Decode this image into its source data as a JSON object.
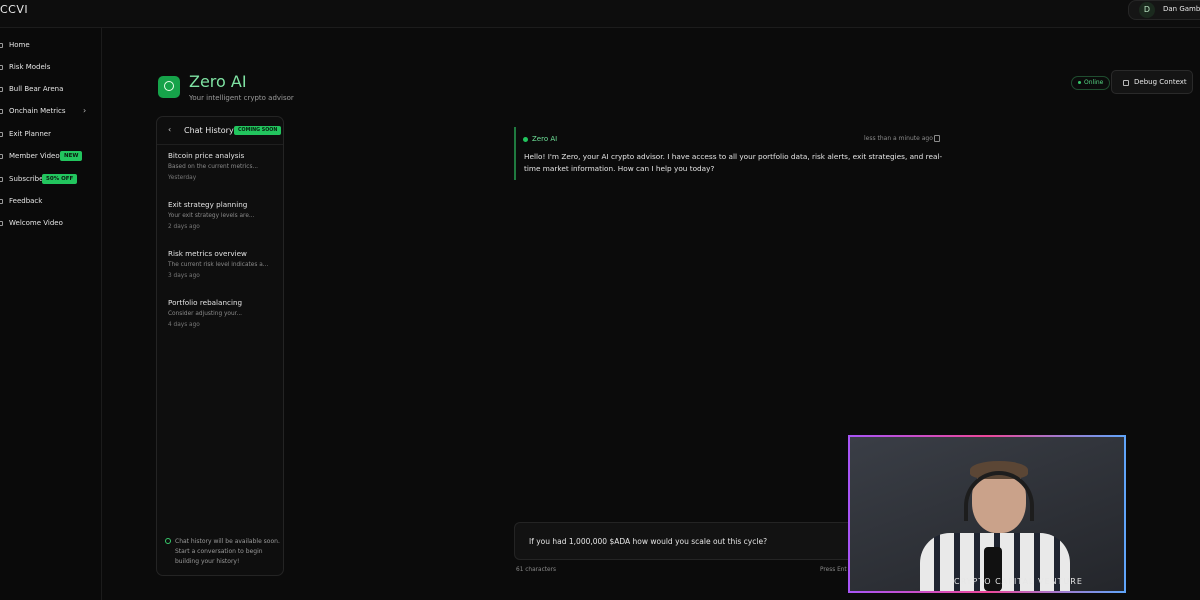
{
  "app": {
    "logo": "CCVI"
  },
  "user": {
    "initial": "D",
    "name": "Dan Gambi"
  },
  "sidebar": {
    "items": [
      {
        "label": "Home"
      },
      {
        "label": "Risk Models"
      },
      {
        "label": "Bull Bear Arena"
      },
      {
        "label": "Onchain Metrics"
      },
      {
        "label": "Exit Planner"
      },
      {
        "label": "Member Videos",
        "badge": "NEW"
      },
      {
        "label": "Subscribe",
        "badge": "50% OFF"
      },
      {
        "label": "Feedback"
      },
      {
        "label": "Welcome Video"
      }
    ]
  },
  "header": {
    "title": "Zero AI",
    "subtitle": "Your intelligent crypto advisor",
    "status": "Online",
    "debug_label": "Debug Context"
  },
  "history": {
    "title": "Chat History",
    "badge": "COMING SOON",
    "items": [
      {
        "title": "Bitcoin price analysis",
        "preview": "Based on the current metrics...",
        "date": "Yesterday"
      },
      {
        "title": "Exit strategy planning",
        "preview": "Your exit strategy levels are...",
        "date": "2 days ago"
      },
      {
        "title": "Risk metrics overview",
        "preview": "The current risk level indicates a...",
        "date": "3 days ago"
      },
      {
        "title": "Portfolio rebalancing",
        "preview": "Consider adjusting your...",
        "date": "4 days ago"
      }
    ],
    "note": "Chat history will be available soon. Start a conversation to begin building your history!"
  },
  "message": {
    "author": "Zero AI",
    "time": "less than a minute ago",
    "text": "Hello! I'm Zero, your AI crypto advisor. I have access to all your portfolio data, risk alerts, exit strategies, and real-time market information. How can I help you today?"
  },
  "composer": {
    "value": "If you had 1,000,000 $ADA how would you scale out this cycle?",
    "char_count": "61 characters",
    "hint": "Press Ent"
  },
  "webcam": {
    "brand_text": "CRYPTO CAPITAL VENTURE"
  }
}
